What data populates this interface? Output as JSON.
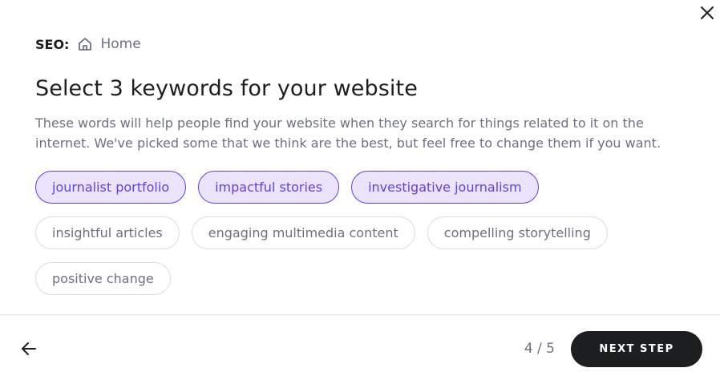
{
  "breadcrumb": {
    "label": "SEO:",
    "icon": "home-icon",
    "page": "Home"
  },
  "title": "Select 3 keywords for your website",
  "description": "These words will help people find your website when they search for things related to it on the internet. We've picked some that we think are the best, but feel free to change them if you want.",
  "keywords": [
    {
      "label": "journalist portfolio",
      "selected": true
    },
    {
      "label": "impactful stories",
      "selected": true
    },
    {
      "label": "investigative journalism",
      "selected": true
    },
    {
      "label": "insightful articles",
      "selected": false
    },
    {
      "label": "engaging multimedia content",
      "selected": false
    },
    {
      "label": "compelling storytelling",
      "selected": false
    },
    {
      "label": "positive change",
      "selected": false
    }
  ],
  "footer": {
    "step": "4 / 5",
    "next_label": "NEXT STEP",
    "back_icon": "arrow-left-icon"
  },
  "close_icon": "close-icon",
  "colors": {
    "accent": "#673de6",
    "accent_bg": "#ebe4ff",
    "dark": "#1d1e20",
    "muted": "#6d7081"
  }
}
